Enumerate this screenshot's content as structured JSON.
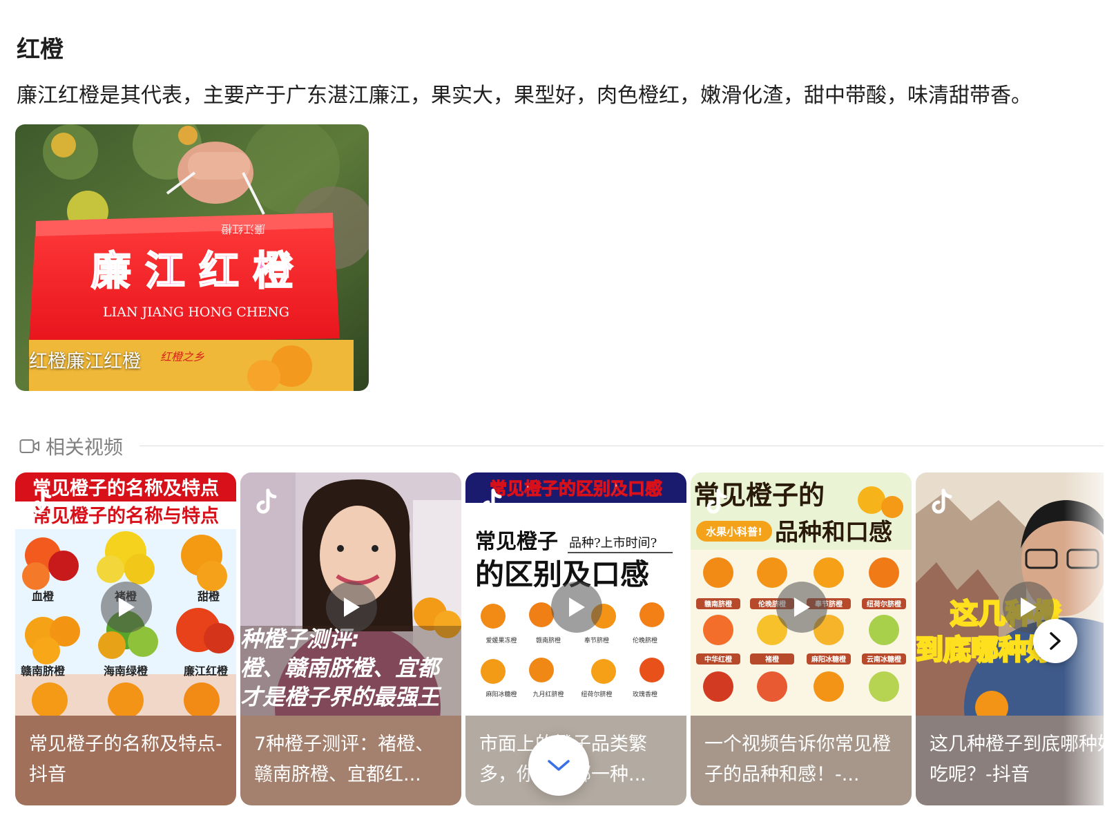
{
  "title": "红橙",
  "description": "廉江红橙是其代表，主要产于广东湛江廉江，果实大，果型好，肉色橙红，嫩滑化渣，甜中带酸，味清甜带香。",
  "main_image": {
    "caption": "红橙廉江红橙",
    "box_text": "廉 江 红 橙",
    "box_pinyin": "LIAN JIANG HONG CHENG",
    "box_top_text": "廉江红橙",
    "box_bottom_text": "红橙之乡"
  },
  "related": {
    "label": "相关视频",
    "videos": [
      {
        "caption": "常见橙子的名称及特点-抖音",
        "caption_bg": "#a0705a",
        "thumb_title1": "常见橙子的名称及特点",
        "thumb_title2": "常见橙子的名称与特点",
        "labels": [
          "血橙",
          "褚橙",
          "甜橙",
          "赣南脐橙",
          "海南绿橙",
          "廉江红橙"
        ]
      },
      {
        "caption": "7种橙子测评：褚橙、赣南脐橙、宜都红...",
        "caption_bg": "#a4806e",
        "overlay1": "种橙子测评:",
        "overlay2": "橙、赣南脐橙、宜都",
        "overlay3": "才是橙子界的最强王"
      },
      {
        "caption": "市面上的橙子品类繁多，你最爱哪一种...",
        "caption_bg": "#b3aba1",
        "thumb_title_top": "常见橙子的区别及口感",
        "thumb_line1": "常见橙子",
        "thumb_tag": "品种?上市时间?",
        "thumb_line2": "的区别及口感",
        "labels": [
          "爱媛果冻橙",
          "赣南脐橙",
          "奉节脐橙",
          "伦晚脐橙",
          "麻阳冰糖橙",
          "九月红脐橙",
          "纽荷尔脐橙",
          "玫瑰香橙"
        ]
      },
      {
        "caption": "一个视频告诉你常见橙子的品种和感！-...",
        "caption_bg": "#a6978a",
        "thumb_title1": "常见橙子的",
        "thumb_badge": "水果小科普!",
        "thumb_title2": "品种和口感",
        "labels": [
          "赣南脐橙",
          "伦晚脐橙",
          "奉节脐橙",
          "纽荷尔脐橙",
          "中华红橙",
          "褚橙",
          "麻阳冰糖橙",
          "云南冰糖橙"
        ]
      },
      {
        "caption": "这几种橙子到底哪种好吃呢？-抖音",
        "caption_bg": "#8a7f7c",
        "overlay1": "这几种橙",
        "overlay2": "到底哪种好"
      }
    ]
  }
}
